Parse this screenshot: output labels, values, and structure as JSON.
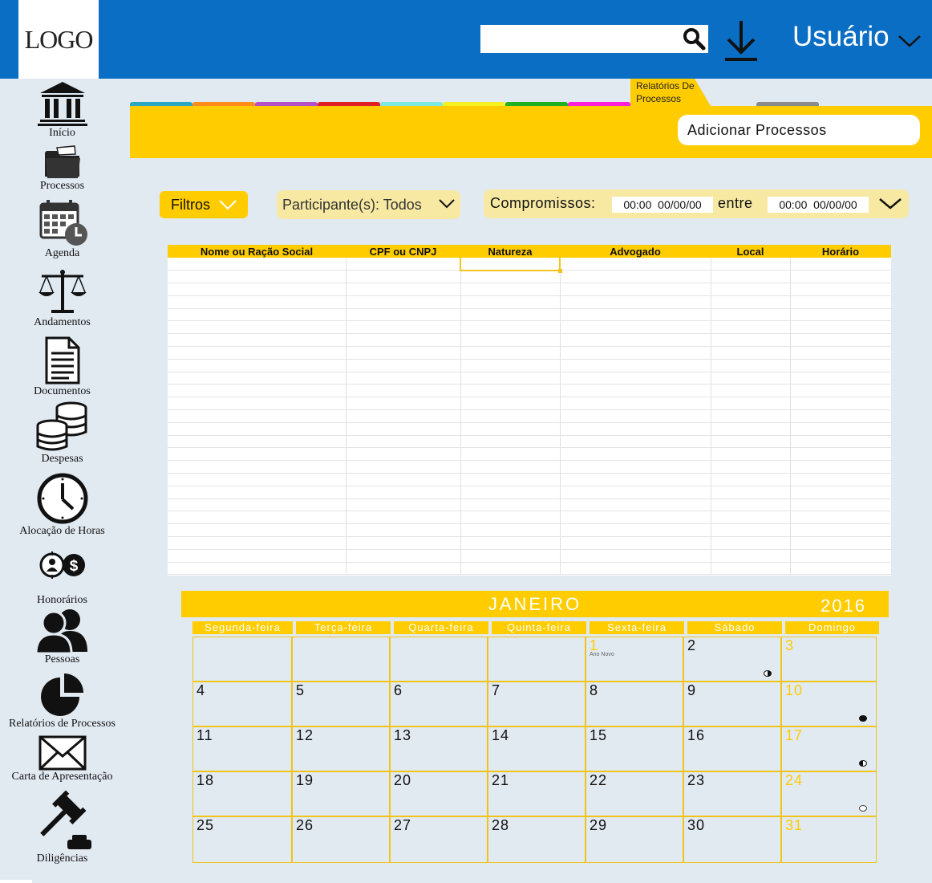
{
  "header": {
    "logo_text": "LOGO",
    "search_placeholder": "",
    "user_label": "Usuário"
  },
  "sidebar": {
    "items": [
      {
        "label": "Início",
        "icon": "bank-icon"
      },
      {
        "label": "Processos",
        "icon": "folder-icon"
      },
      {
        "label": "Agenda",
        "icon": "calendar-clock-icon"
      },
      {
        "label": "Andamentos",
        "icon": "scales-icon"
      },
      {
        "label": "Documentos",
        "icon": "document-icon"
      },
      {
        "label": "Despesas",
        "icon": "coins-icon"
      },
      {
        "label": "Alocação de Horas",
        "icon": "clock-icon"
      },
      {
        "label": "Honorários",
        "icon": "person-money-icon"
      },
      {
        "label": "Pessoas",
        "icon": "people-icon"
      },
      {
        "label": "Relatórios de Processos",
        "icon": "pie-chart-icon"
      },
      {
        "label": "Carta de Apresentação",
        "icon": "envelope-icon"
      },
      {
        "label": "Diligências",
        "icon": "gavel-icon"
      }
    ]
  },
  "tabs": {
    "colors": [
      "#29a8c4",
      "#ff8c1a",
      "#b450c8",
      "#e02020",
      "#7de8e0",
      "#f5f020",
      "#21b021",
      "#ff1fd6"
    ],
    "active_label": "Relatórios De Processos",
    "active_color": "#ffcc00",
    "trailing_color": "#8a8a8a"
  },
  "toolbar": {
    "add_button": "Adicionar Processos"
  },
  "filters": {
    "filtros_label": "Filtros",
    "participantes_label": "Participante(s): Todos",
    "compromissos_label": "Compromissos:",
    "start_value": "00:00  00/00/00",
    "entre_label": "entre",
    "end_value": "00:00  00/00/00"
  },
  "table": {
    "columns": [
      "Nome ou Ração Social",
      "CPF ou CNPJ",
      "Natureza",
      "Advogado",
      "Local",
      "Horário"
    ],
    "row_count": 25
  },
  "calendar": {
    "month": "JANEIRO",
    "year": "2016",
    "weekdays": [
      "Segunda-feira",
      "Terça-feira",
      "Quarta-feira",
      "Quinta-feira",
      "Sexta-feira",
      "Sábado",
      "Domingo"
    ],
    "holiday_note": "Ano Novo",
    "weeks": [
      [
        "",
        "",
        "",
        "",
        "1",
        "2",
        "3"
      ],
      [
        "4",
        "5",
        "6",
        "7",
        "8",
        "9",
        "10"
      ],
      [
        "11",
        "12",
        "13",
        "14",
        "15",
        "16",
        "17"
      ],
      [
        "18",
        "19",
        "20",
        "21",
        "22",
        "23",
        "24"
      ],
      [
        "25",
        "26",
        "27",
        "28",
        "29",
        "30",
        "31"
      ]
    ],
    "moon_phases": {
      "2": "waning-quarter",
      "10": "new",
      "17": "waxing-quarter",
      "24": "full"
    }
  },
  "colors": {
    "header_blue": "#0b6ec5",
    "accent_yellow": "#ffcc00",
    "page_background": "#e1e9f1"
  }
}
